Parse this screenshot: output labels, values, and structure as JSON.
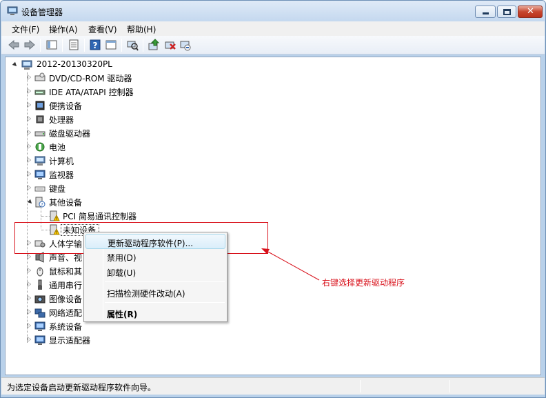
{
  "window": {
    "title": "设备管理器"
  },
  "menubar": [
    "文件(F)",
    "操作(A)",
    "查看(V)",
    "帮助(H)"
  ],
  "tree": {
    "root": "2012-20130320PL",
    "categories": [
      {
        "label": "DVD/CD-ROM 驱动器",
        "icon": "dvd-drive-icon"
      },
      {
        "label": "IDE ATA/ATAPI 控制器",
        "icon": "ide-controller-icon"
      },
      {
        "label": "便携设备",
        "icon": "portable-device-icon"
      },
      {
        "label": "处理器",
        "icon": "processor-icon"
      },
      {
        "label": "磁盘驱动器",
        "icon": "disk-drive-icon"
      },
      {
        "label": "电池",
        "icon": "battery-icon"
      },
      {
        "label": "计算机",
        "icon": "computer-icon"
      },
      {
        "label": "监视器",
        "icon": "monitor-icon"
      },
      {
        "label": "键盘",
        "icon": "keyboard-icon"
      },
      {
        "label": "其他设备",
        "icon": "other-devices-icon",
        "children": [
          {
            "label": "PCI 简易通讯控制器",
            "icon": "warning-device-icon"
          },
          {
            "label": "未知设备",
            "icon": "warning-device-icon"
          }
        ]
      },
      {
        "label": "人体学输",
        "icon": "hid-icon"
      },
      {
        "label": "声音、视",
        "icon": "sound-icon"
      },
      {
        "label": "鼠标和其",
        "icon": "mouse-icon"
      },
      {
        "label": "通用串行",
        "icon": "usb-icon"
      },
      {
        "label": "图像设备",
        "icon": "imaging-icon"
      },
      {
        "label": "网络适配",
        "icon": "network-adapter-icon"
      },
      {
        "label": "系统设备",
        "icon": "system-device-icon"
      },
      {
        "label": "显示适配器",
        "icon": "display-adapter-icon"
      }
    ]
  },
  "context_menu": {
    "update": "更新驱动程序软件(P)...",
    "disable": "禁用(D)",
    "uninstall": "卸载(U)",
    "scan": "扫描检测硬件改动(A)",
    "properties": "属性(R)"
  },
  "annotation": "右键选择更新驱动程序",
  "status": "为选定设备启动更新驱动程序软件向导。",
  "colors": {
    "annotation": "#d8101a",
    "titlebar": "#c4d8ef",
    "menu_hover": "#daeefa"
  }
}
